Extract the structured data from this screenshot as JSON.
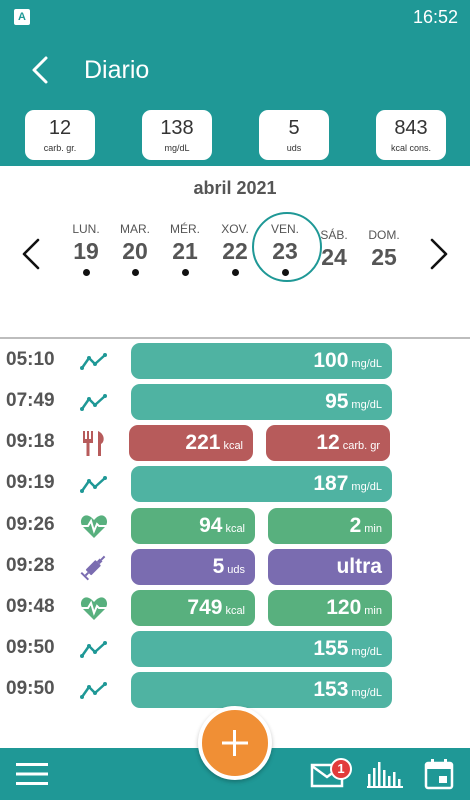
{
  "status_bar": {
    "time": "16:52",
    "app_icon_letter": "A"
  },
  "header": {
    "title": "Diario"
  },
  "stats": [
    {
      "value": "12",
      "unit": "carb. gr."
    },
    {
      "value": "138",
      "unit": "mg/dL"
    },
    {
      "value": "5",
      "unit": "uds"
    },
    {
      "value": "843",
      "unit": "kcal cons."
    }
  ],
  "calendar": {
    "month": "abril 2021",
    "days": [
      {
        "name": "LUN.",
        "num": "19"
      },
      {
        "name": "MAR.",
        "num": "20"
      },
      {
        "name": "MÉR.",
        "num": "21"
      },
      {
        "name": "XOV.",
        "num": "22"
      },
      {
        "name": "VEN.",
        "num": "23"
      },
      {
        "name": "SÁB.",
        "num": "24"
      },
      {
        "name": "DOM.",
        "num": "25"
      }
    ]
  },
  "entries": [
    {
      "time": "05:10",
      "icon": "glucose-trend-icon",
      "value": "100",
      "unit": "mg/dL"
    },
    {
      "time": "07:49",
      "icon": "glucose-trend-icon",
      "value": "95",
      "unit": "mg/dL"
    },
    {
      "time": "09:18",
      "icon": "fork-knife-icon",
      "value": "221",
      "unit": "kcal",
      "value2": "12",
      "unit2": "carb. gr"
    },
    {
      "time": "09:19",
      "icon": "glucose-trend-icon",
      "value": "187",
      "unit": "mg/dL"
    },
    {
      "time": "09:26",
      "icon": "heart-pulse-icon",
      "value": "94",
      "unit": "kcal",
      "value2": "2",
      "unit2": "min"
    },
    {
      "time": "09:28",
      "icon": "syringe-icon",
      "value": "5",
      "unit": "uds",
      "value2": "ultra",
      "unit2": ""
    },
    {
      "time": "09:48",
      "icon": "heart-pulse-icon",
      "value": "749",
      "unit": "kcal",
      "value2": "120",
      "unit2": "min"
    },
    {
      "time": "09:50",
      "icon": "glucose-trend-icon",
      "value": "155",
      "unit": "mg/dL"
    },
    {
      "time": "09:50",
      "icon": "glucose-trend-icon",
      "value": "153",
      "unit": "mg/dL"
    }
  ],
  "bottom_bar": {
    "messages_badge": "1"
  },
  "colors": {
    "primary": "#1f9896",
    "glucose": "#4fb3a2",
    "meal": "#b75b5b",
    "activity": "#58b07e",
    "insulin": "#7a6cb0",
    "fab": "#f08f35",
    "badge": "#e23b3b"
  }
}
